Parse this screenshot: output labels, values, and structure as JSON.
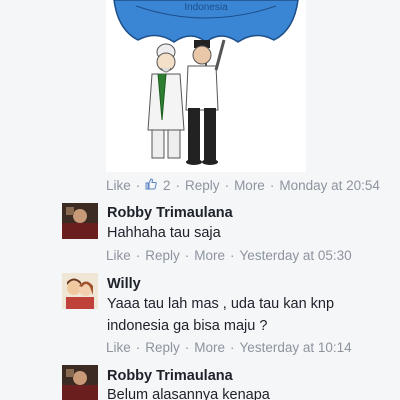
{
  "post": {
    "umbrella_text": "Indonesia",
    "meta": {
      "like": "Like",
      "like_count": "2",
      "reply": "Reply",
      "more": "More",
      "time": "Monday at 20:54"
    }
  },
  "comments": [
    {
      "author": "Robby Trimaulana",
      "lines": [
        "Hahhaha tau saja"
      ],
      "like": "Like",
      "reply": "Reply",
      "more": "More",
      "time": "Yesterday at 05:30"
    },
    {
      "author": "Willy",
      "lines": [
        "Yaaa tau lah mas , uda tau kan knp",
        "indonesia ga bisa maju ?"
      ],
      "like": "Like",
      "reply": "Reply",
      "more": "More",
      "time": "Yesterday at 10:14"
    },
    {
      "author": "Robby Trimaulana",
      "lines": [
        "Belum alasannya kenapa"
      ]
    }
  ],
  "colors": {
    "background": "#f5f6f8",
    "meta_text": "#8d949e",
    "body_text": "#1d2129",
    "umbrella": "#3a86d4",
    "like_icon": "#8d949e"
  },
  "icons": {
    "like_count_icon": "thumbs-up-icon"
  }
}
